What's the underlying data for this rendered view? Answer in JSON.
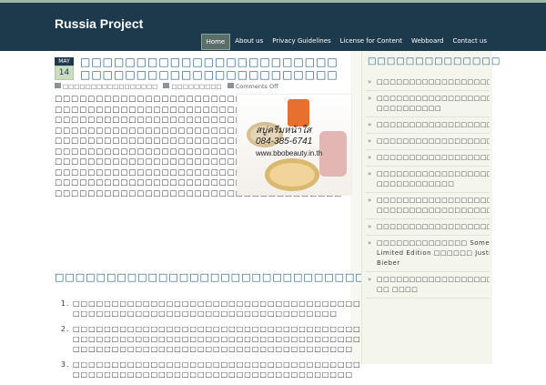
{
  "header": {
    "title": "Russia Project",
    "nav": [
      "Home",
      "About us",
      "Privacy Guidelines",
      "License for Content",
      "Webboard",
      "Contact us"
    ]
  },
  "post": {
    "date_month": "MAY",
    "date_day": "14",
    "title": "□□□□□□□□□□□□□□□□□□□□□□□□□□□□□□□□□□□□□□□□□□□□□□",
    "meta_author": "□□□□□□□□□□□□□□□□□",
    "meta_category": "□□□□□□□□□",
    "meta_comments": "Comments Off",
    "paragraph_lines": [
      "□□□□□□□□□□□□□□□□□□□□□□□□□□□□□□□□",
      "□□□□□□□□□□□□□□□□□□□□□□□□□□□□□□□□□□□□□",
      "□□□□□□□□□□□□□□□□□□□□□□□□□□□□□□□□□□□",
      "□□□□□□□□□□□□□□□□□□□□□□□□□□□□□□□□□□□□",
      "□□□□□□□□□□□□□□□□□□□□□□□□□□□□□□□□□□□",
      "□□□□□□□□□□□□□□□□□□□□□□□□□□□□□□□□□□",
      "□□□□□□□□□□□□□□□□□□□□□□□□□□□□□□□□□□",
      "□□□□□□□□□□□□□□□□□□□□□□□□□□□□□□□□□□",
      "□□□□□□□□□□□□□□□□□□□□□□□□□□□□□□□□□□□□",
      "□□□□□□□□□□□□□□□□□□□□□□□□□□□□□□□□□□□"
    ],
    "ad_lines": [
      "สบู่ครีมหน้าใส",
      "084-385-6741",
      "www.bbobeauty.in.th"
    ],
    "subhead": "□□□□□□□□□□□□□□□□□□□□□□□□□□□□□□□□□□□□□□□",
    "list_items": [
      [
        "□□□□□□□□□□□□□□□□□□□□□□□□□□□□□□□□□□□□□□□□",
        "□□□□□□□□□□□□□□□□□□□□□□□□□□□□□□□□□□"
      ],
      [
        "□□□□□□□□□□□□□□□□□□□□□□□□□□□□□□□□□□□□□□□□",
        "□□□□□□□□□□□□□□□□□□□□□□□□□□□□□□□□□□□□□□□□",
        "□□□□□□□□□□□□□□□□□□□□□□□□□□□□□□□□□□□□"
      ],
      [
        "□□□□□□□□□□□□□□□□□□□□□□□□□□□□□□□□□□□□□□□",
        "□□□□□□□□□□□□□□□□□□□□□□□□□□□□□□□□□□□□"
      ]
    ]
  },
  "sidebar": {
    "title": "□□□□□□□□□□□□□□",
    "items": [
      [
        "□□□□□□□□□□□□□□□□□□□□□"
      ],
      [
        "□□□□□□□□□□□□□□□□□□□□□□",
        "□□□□□□□□□□"
      ],
      [
        "□□□□□□□□□□□□□□□□□□□□□□□"
      ],
      [
        "□□□□□□□□□□□□□□□□□□□□□□□□□"
      ],
      [
        "□□□□□□□□□□□□□□□□□□□□ □□□□□□"
      ],
      [
        "□□□□□□□□□□□□□□□□□□□□□□□□□",
        "□□□□□□□□□□□□"
      ],
      [
        "□□□□□□□□□□□□□□□□□□□□□□□□",
        "□□□□□□□□□□□□□□□□□□□□□□□"
      ],
      [
        "□□□□□□□□□□□□□□□□□□□□□□□?"
      ],
      [
        "□□□□□□□□□□□□□□ Someday",
        "Limited Edition □□□□□□ Justin",
        "Bieber"
      ],
      [
        "□□□□□□□□□□□□□□□□□□□□□□□",
        "□□ □□□□"
      ]
    ]
  }
}
